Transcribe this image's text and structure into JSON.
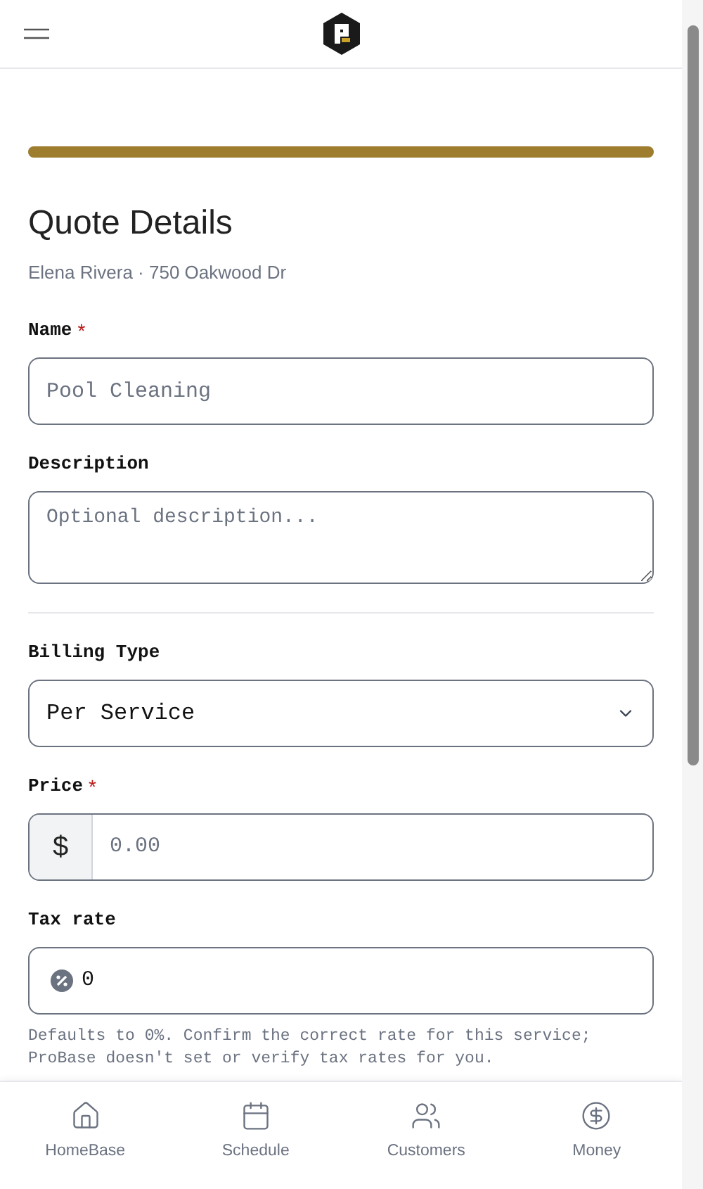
{
  "progress": {
    "level": 1
  },
  "title": "Quote Details",
  "subtitle": "Elena Rivera · 750 Oakwood Dr",
  "fields": [
    {
      "kind": "text",
      "label": "Name",
      "required_mark": "*",
      "placeholder": "Pool Cleaning"
    },
    {
      "kind": "textarea",
      "label": "Description",
      "placeholder": "Optional description..."
    },
    {
      "kind": "divider"
    },
    {
      "kind": "select",
      "label": "Billing Type",
      "value": "Per Service"
    },
    {
      "kind": "currency",
      "label": "Price",
      "required_mark": "*",
      "prefix": "$",
      "placeholder": "0.00"
    },
    {
      "kind": "percent",
      "label": "Tax rate",
      "value": "0",
      "help": "Defaults to 0%. Confirm the correct rate for this service; ProBase doesn't set or verify tax rates for you."
    }
  ],
  "nav": [
    {
      "kind": "home",
      "label": "HomeBase"
    },
    {
      "kind": "calendar",
      "label": "Schedule"
    },
    {
      "kind": "users",
      "label": "Customers"
    },
    {
      "kind": "money",
      "label": "Money"
    }
  ]
}
